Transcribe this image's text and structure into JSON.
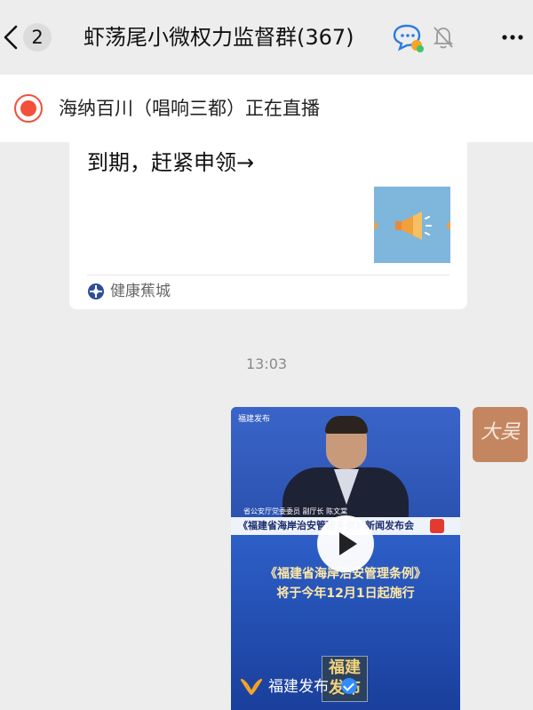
{
  "header": {
    "unread_count": "2",
    "title": "虾荡尾小微权力监督群(367)",
    "icons": [
      "back-chevron-icon",
      "chat-bubble-icon",
      "mute-bell-icon",
      "more-icon"
    ]
  },
  "live_banner": {
    "text": "海纳百川（唱响三都）正在直播",
    "accent": "#f2503a"
  },
  "article_card": {
    "title_fragment": "到期，赶紧申领→",
    "source": "健康蕉城",
    "image_color": "#7fb6dc"
  },
  "timestamp": "13:03",
  "video_message": {
    "logo_text": "福建发布",
    "speaker_caption": "省公安厅党委委员  副厅长    陈文棠",
    "banner": "《福建省海岸治安管理条例》新闻发布会",
    "banner_badge": "福",
    "headline_1": "《福建省海岸治安管理条例》",
    "headline_2": "将于今年12月1日起施行",
    "stamp": "福建发布",
    "source": "福建发布"
  },
  "sender_avatar": {
    "text": "大吴",
    "color": "#c48661"
  }
}
